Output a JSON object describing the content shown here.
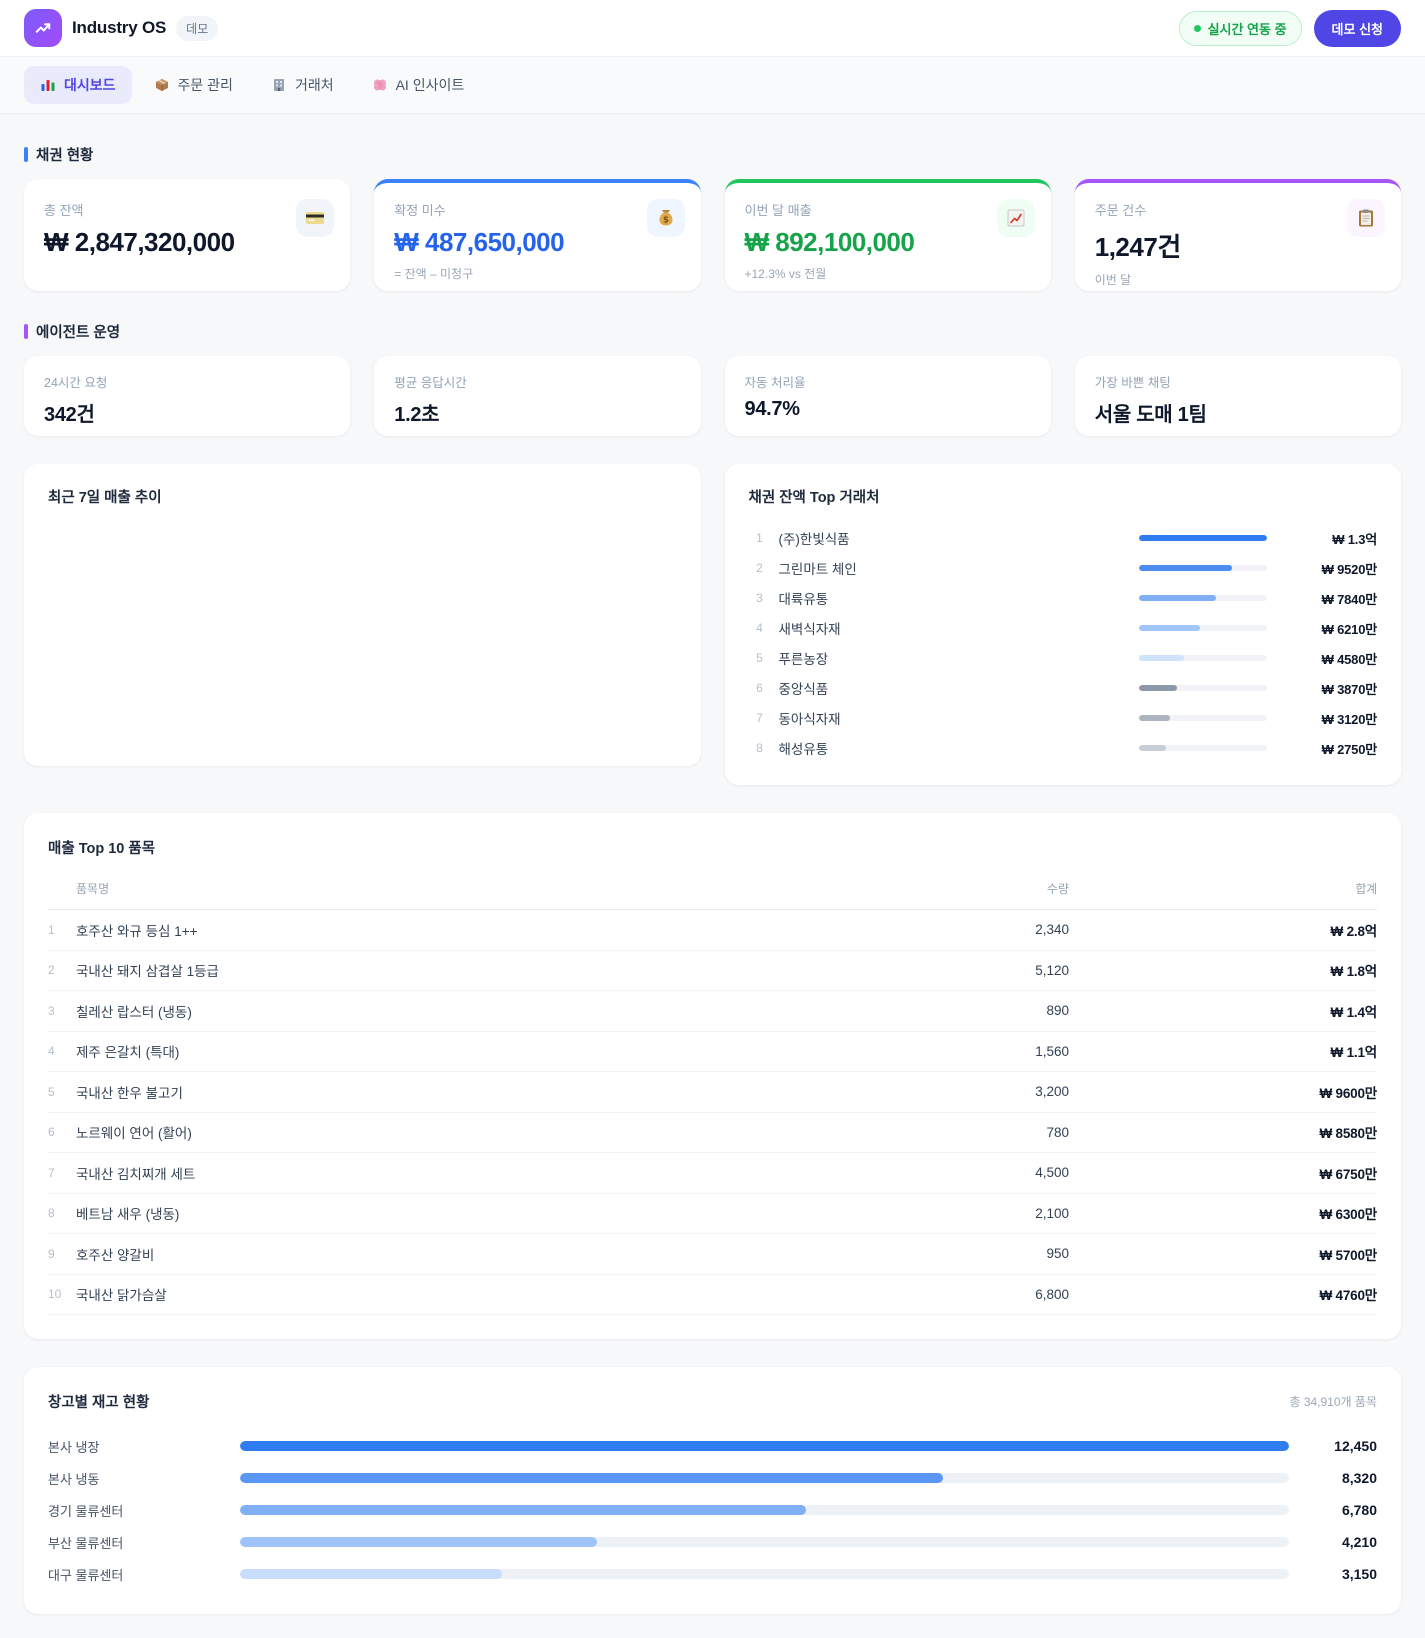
{
  "header": {
    "app_title": "Industry OS",
    "demo_badge": "데모",
    "live_status": "실시간 연동 중",
    "cta_label": "데모 신청"
  },
  "nav": {
    "tabs": [
      {
        "label": "대시보드",
        "active": true
      },
      {
        "label": "주문 관리",
        "active": false
      },
      {
        "label": "거래처",
        "active": false
      },
      {
        "label": "AI 인사이트",
        "active": false
      }
    ]
  },
  "colors": {
    "brand": "#4F46E5",
    "accent_blue": "#3B82F6",
    "accent_green": "#22C55E",
    "accent_purple": "#A855F7",
    "value_blue": "#2563EB",
    "value_green": "#16A34A"
  },
  "receivables": {
    "title": "채권 현황",
    "cards": [
      {
        "label": "총 잔액",
        "value": "₩ 2,847,320,000",
        "sub": ""
      },
      {
        "label": "확정 미수",
        "value": "₩ 487,650,000",
        "sub": "= 잔액 – 미청구"
      },
      {
        "label": "이번 달 매출",
        "value": "₩ 892,100,000",
        "sub": "+12.3% vs 전월"
      },
      {
        "label": "주문 건수",
        "value": "1,247건",
        "sub": "이번 달"
      }
    ]
  },
  "agent": {
    "title": "에이전트 운영",
    "cards": [
      {
        "label": "24시간 요청",
        "value": "342건"
      },
      {
        "label": "평균 응답시간",
        "value": "1.2초"
      },
      {
        "label": "자동 처리율",
        "value": "94.7%"
      },
      {
        "label": "가장 바쁜 채팅",
        "value": "서울 도매 1팀"
      }
    ]
  },
  "sales_trend": {
    "title": "최근 7일 매출 추이"
  },
  "top_accounts": {
    "title": "채권 잔액 Top 거래처",
    "rows": [
      {
        "rank": "1",
        "name": "(주)한빛식품",
        "amount": "₩ 1.3억",
        "pct": 100,
        "color": "#2F7BF0"
      },
      {
        "rank": "2",
        "name": "그린마트 체인",
        "amount": "₩ 9520만",
        "pct": 73,
        "color": "#4D8DF2"
      },
      {
        "rank": "3",
        "name": "대륙유통",
        "amount": "₩ 7840만",
        "pct": 60,
        "color": "#7FB0F6"
      },
      {
        "rank": "4",
        "name": "새벽식자재",
        "amount": "₩ 6210만",
        "pct": 48,
        "color": "#A3C6FA"
      },
      {
        "rank": "5",
        "name": "푸른농장",
        "amount": "₩ 4580만",
        "pct": 35,
        "color": "#CFE3FC"
      },
      {
        "rank": "6",
        "name": "중앙식품",
        "amount": "₩ 3870만",
        "pct": 30,
        "color": "#8E99A8"
      },
      {
        "rank": "7",
        "name": "동아식자재",
        "amount": "₩ 3120만",
        "pct": 24,
        "color": "#ACB4BF"
      },
      {
        "rank": "8",
        "name": "해성유통",
        "amount": "₩ 2750만",
        "pct": 21,
        "color": "#C8CED6"
      }
    ]
  },
  "top_items": {
    "title": "매출 Top 10 품목",
    "columns": {
      "name": "품목명",
      "qty": "수량",
      "total": "합계"
    },
    "rows": [
      {
        "rank": "1",
        "name": "호주산 와규 등심 1++",
        "qty": "2,340",
        "total": "₩ 2.8억"
      },
      {
        "rank": "2",
        "name": "국내산 돼지 삼겹살 1등급",
        "qty": "5,120",
        "total": "₩ 1.8억"
      },
      {
        "rank": "3",
        "name": "칠레산 랍스터 (냉동)",
        "qty": "890",
        "total": "₩ 1.4억"
      },
      {
        "rank": "4",
        "name": "제주 은갈치 (특대)",
        "qty": "1,560",
        "total": "₩ 1.1억"
      },
      {
        "rank": "5",
        "name": "국내산 한우 불고기",
        "qty": "3,200",
        "total": "₩ 9600만"
      },
      {
        "rank": "6",
        "name": "노르웨이 연어 (활어)",
        "qty": "780",
        "total": "₩ 8580만"
      },
      {
        "rank": "7",
        "name": "국내산 김치찌개 세트",
        "qty": "4,500",
        "total": "₩ 6750만"
      },
      {
        "rank": "8",
        "name": "베트남 새우 (냉동)",
        "qty": "2,100",
        "total": "₩ 6300만"
      },
      {
        "rank": "9",
        "name": "호주산 양갈비",
        "qty": "950",
        "total": "₩ 5700만"
      },
      {
        "rank": "10",
        "name": "국내산 닭가슴살",
        "qty": "6,800",
        "total": "₩ 4760만"
      }
    ]
  },
  "warehouse": {
    "title": "창고별 재고 현황",
    "total_label": "총 34,910개 품목",
    "rows": [
      {
        "name": "본사 냉장",
        "value": "12,450",
        "pct": 100,
        "color": "#2F7BF0"
      },
      {
        "name": "본사 냉동",
        "value": "8,320",
        "pct": 67,
        "color": "#5A96F3"
      },
      {
        "name": "경기 물류센터",
        "value": "6,780",
        "pct": 54,
        "color": "#7FB0F6"
      },
      {
        "name": "부산 물류센터",
        "value": "4,210",
        "pct": 34,
        "color": "#9FC3F9"
      },
      {
        "name": "대구 물류센터",
        "value": "3,150",
        "pct": 25,
        "color": "#C7DDFB"
      }
    ]
  }
}
